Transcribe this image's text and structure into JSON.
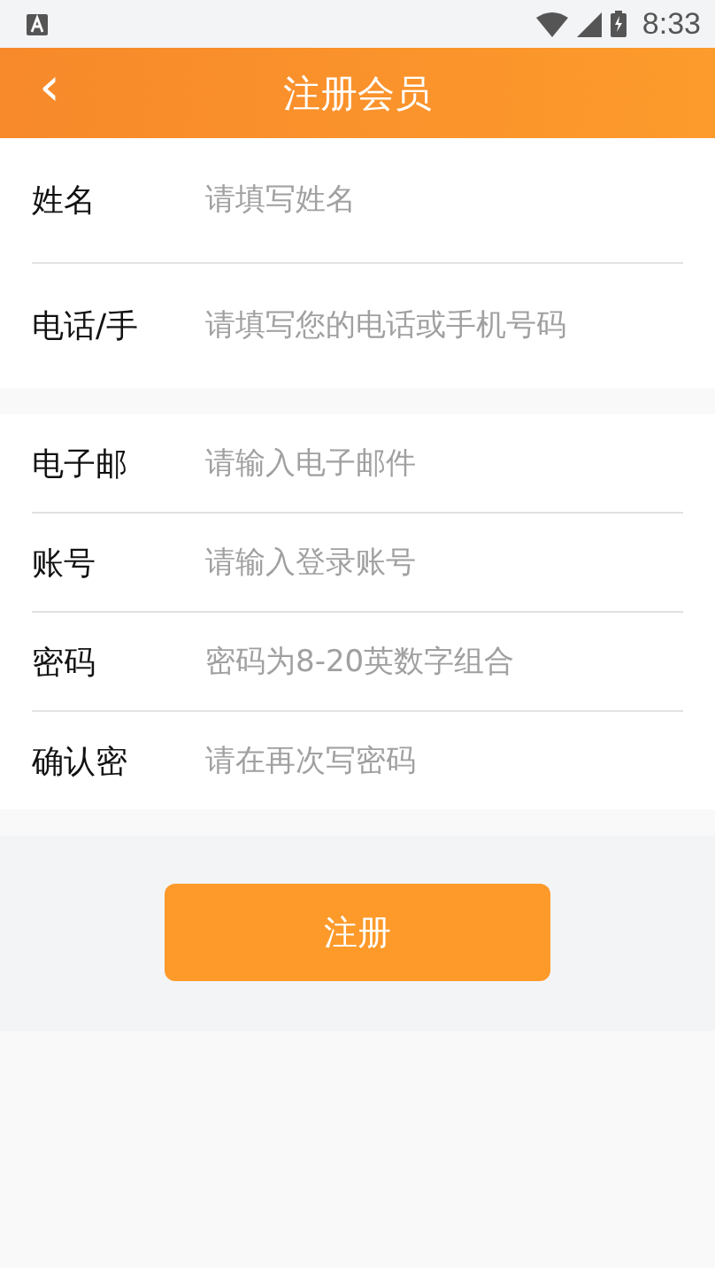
{
  "status_bar": {
    "time": "8:33"
  },
  "header": {
    "title": "注册会员",
    "back": "‹"
  },
  "sections": [
    {
      "fields": [
        {
          "label": "姓名",
          "placeholder": "请填写姓名"
        },
        {
          "label": "电话/手",
          "placeholder": "请填写您的电话或手机号码"
        }
      ]
    },
    {
      "fields": [
        {
          "label": "电子邮",
          "placeholder": "请输入电子邮件"
        },
        {
          "label": "账号",
          "placeholder": "请输入登录账号"
        },
        {
          "label": "密码",
          "placeholder": "密码为8-20英数字组合"
        },
        {
          "label": "确认密",
          "placeholder": "请在再次写密码"
        }
      ]
    }
  ],
  "submit": "注册"
}
